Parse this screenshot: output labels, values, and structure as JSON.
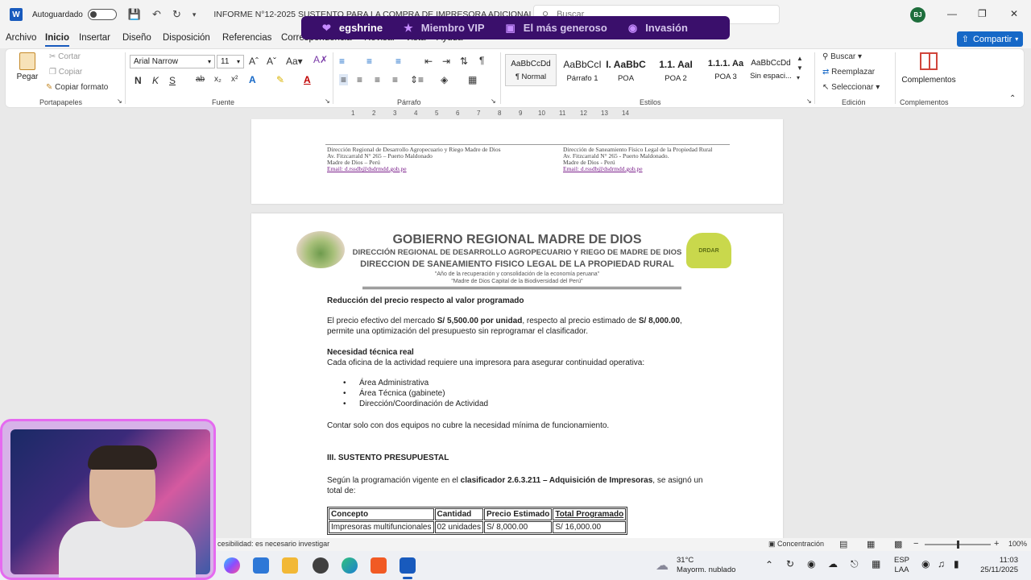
{
  "titlebar": {
    "autosave_label": "Autoguardado",
    "doc_title": "INFORME N°12-2025 SUSTENTO PARA LA COMPRA DE IMPRESORA ADICIONAL",
    "search_placeholder": "Buscar",
    "user_initials": "BJ"
  },
  "banner": {
    "items": [
      "egshrine",
      "Miembro VIP",
      "El más generoso",
      "Invasión"
    ]
  },
  "menu": {
    "tabs": [
      "Archivo",
      "Inicio",
      "Insertar",
      "Diseño",
      "Disposición",
      "Referencias",
      "Correspondencia",
      "Revisar",
      "Vista",
      "Ayuda"
    ],
    "share_label": "Compartir"
  },
  "ribbon": {
    "clipboard": {
      "paste": "Pegar",
      "cut": "Cortar",
      "copy": "Copiar",
      "format_painter": "Copiar formato",
      "label": "Portapapeles"
    },
    "font": {
      "family": "Arial Narrow",
      "size": "11",
      "label": "Fuente",
      "bold": "N",
      "italic": "K",
      "underline": "S"
    },
    "paragraph": {
      "label": "Párrafo"
    },
    "styles": {
      "label": "Estilos",
      "items": [
        {
          "sample": "AaBbCcDd",
          "name": "¶ Normal"
        },
        {
          "sample": "AaBbCcI",
          "name": "Párrafo 1"
        },
        {
          "sample": "I. AaBbC",
          "name": "POA"
        },
        {
          "sample": "1.1. AaI",
          "name": "POA 2"
        },
        {
          "sample": "1.1.1. Aa",
          "name": "POA 3"
        },
        {
          "sample": "AaBbCcDd",
          "name": "Sin espaci..."
        }
      ]
    },
    "editing": {
      "label": "Edición",
      "find": "Buscar",
      "replace": "Reemplazar",
      "select": "Seleccionar"
    },
    "addins": {
      "label": "Complementos",
      "button": "Complementos"
    }
  },
  "ruler_numbers": [
    "1",
    "2",
    "3",
    "4",
    "5",
    "6",
    "7",
    "8",
    "9",
    "10",
    "11",
    "12",
    "13",
    "14"
  ],
  "page1_footer": {
    "left": [
      "Dirección Regional de Desarrollo Agropecuario y Riego Madre de Dios",
      "Av. Fitzcarrald N° 265 – Puerto Maldonado",
      "Madre de Dios – Perú",
      "Email: d.rssdb@dsdrmdd.gob.pe"
    ],
    "right": [
      "Dirección de Saneamiento Físico Legal de la Propiedad Rural",
      "Av. Fitzcarrald N° 265 - Puerto Maldonado.",
      "Madre de Dios - Perú",
      "Email: d.rssdb@dsdrmdd.gob.pe"
    ]
  },
  "page2": {
    "gov_title": "GOBIERNO REGIONAL MADRE DE DIOS",
    "sub1": "DIRECCIÓN REGIONAL DE DESARROLLO AGROPECUARIO Y RIEGO DE MADRE DE DIOS",
    "sub2": "DIRECCION DE SANEAMIENTO FISICO LEGAL DE LA PROPIEDAD RURAL",
    "motto1": "\"Año de la recuperación y consolidación de la economía peruana\"",
    "motto2": "\"Madre de Dios Capital de la Biodiversidad del Perú\"",
    "logo_right_text": "DRDAR",
    "h_reduccion": "Reducción del precio respecto al valor programado",
    "p1_a": "El precio efectivo del mercado ",
    "p1_b": "S/ 5,500.00 por unidad",
    "p1_c": ", respecto al precio estimado de ",
    "p1_d": "S/ 8,000.00",
    "p1_e": ",",
    "p1_line2": "permite una optimización del presupuesto sin reprogramar el clasificador.",
    "h_necesidad": "Necesidad técnica real",
    "p2": "Cada oficina de la actividad requiere una impresora para asegurar continuidad operativa:",
    "bullets": [
      "Área Administrativa",
      "Área Técnica (gabinete)",
      "Dirección/Coordinación de Actividad"
    ],
    "p3": "Contar solo con dos equipos no cubre la necesidad mínima de funcionamiento.",
    "h_sustento": "III. SUSTENTO PRESUPUESTAL",
    "p4_a": "Según la programación vigente en el ",
    "p4_b": "clasificador 2.6.3.211 – Adquisición de Impresoras",
    "p4_c": ", se asignó un",
    "p4_line2": "total de:",
    "table": {
      "headers": [
        "Concepto",
        "Cantidad",
        "Precio Estimado",
        "Total Programado"
      ],
      "rows": [
        [
          "Impresoras multifuncionales",
          "02 unidades",
          "S/ 8,000.00",
          "S/ 16,000.00"
        ]
      ]
    }
  },
  "statusbar": {
    "accessibility": "cesibilidad: es necesario investigar",
    "focus": "Concentración",
    "zoom": "100%"
  },
  "taskbar": {
    "weather_temp": "31°C",
    "weather_desc": "Mayorm. nublado",
    "lang1": "ESP",
    "lang2": "LAA",
    "time": "11:03",
    "date": "25/11/2025"
  },
  "colors": {
    "accent": "#185abd",
    "banner": "#3a0f6b",
    "share": "#1668c7"
  }
}
